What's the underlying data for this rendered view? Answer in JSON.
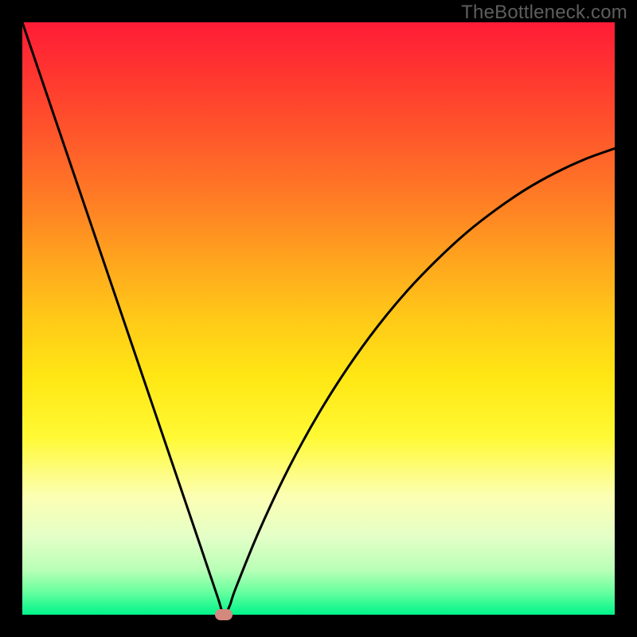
{
  "watermark": "TheBottleneck.com",
  "chart_data": {
    "type": "line",
    "title": "",
    "xlabel": "",
    "ylabel": "",
    "xlim": [
      0,
      100
    ],
    "ylim": [
      0,
      100
    ],
    "grid": false,
    "series": [
      {
        "name": "curve",
        "x": [
          0,
          5,
          10,
          15,
          20,
          25,
          30,
          33,
          34,
          35,
          36,
          40,
          45,
          50,
          55,
          60,
          65,
          70,
          75,
          80,
          85,
          90,
          95,
          100
        ],
        "y": [
          100,
          85.3,
          70.6,
          55.9,
          41.2,
          26.5,
          11.8,
          2.9,
          0,
          1.5,
          4.4,
          14.2,
          24.8,
          33.9,
          41.8,
          48.7,
          54.7,
          59.9,
          64.5,
          68.4,
          71.8,
          74.6,
          76.9,
          78.7
        ]
      }
    ],
    "marker": {
      "x": 34,
      "y": 0,
      "color": "#d4897e"
    },
    "background_gradient": {
      "top": "#ff1b37",
      "bottom": "#00f58a"
    }
  }
}
